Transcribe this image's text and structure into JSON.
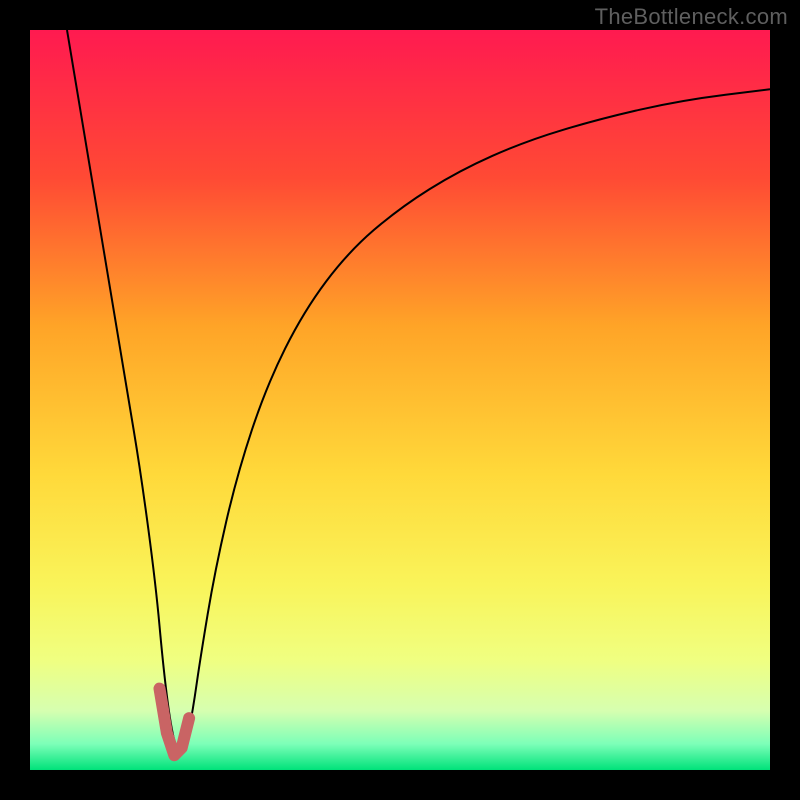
{
  "watermark": "TheBottleneck.com",
  "colors": {
    "frame_bg": "#000000",
    "watermark": "#5f5f5f",
    "curve": "#000000",
    "marker": "#c96464",
    "gradient_stops": [
      {
        "offset": 0.0,
        "color": "#ff1a50"
      },
      {
        "offset": 0.2,
        "color": "#ff4a34"
      },
      {
        "offset": 0.4,
        "color": "#ffa427"
      },
      {
        "offset": 0.6,
        "color": "#ffd93a"
      },
      {
        "offset": 0.75,
        "color": "#f9f45a"
      },
      {
        "offset": 0.85,
        "color": "#f0ff80"
      },
      {
        "offset": 0.92,
        "color": "#d6ffb0"
      },
      {
        "offset": 0.965,
        "color": "#7cffb8"
      },
      {
        "offset": 1.0,
        "color": "#00e27a"
      }
    ]
  },
  "chart_data": {
    "type": "line",
    "title": "",
    "xlabel": "",
    "ylabel": "",
    "xlim": [
      0,
      100
    ],
    "ylim": [
      0,
      100
    ],
    "grid": false,
    "legend": false,
    "series": [
      {
        "name": "bottleneck-curve",
        "x": [
          5,
          7,
          9,
          11,
          13,
          15,
          17,
          18,
          19,
          20,
          21,
          22,
          23,
          25,
          28,
          32,
          37,
          43,
          50,
          58,
          67,
          77,
          88,
          100
        ],
        "y": [
          100,
          88,
          76,
          64,
          52,
          40,
          25,
          14,
          6,
          2,
          3,
          8,
          15,
          27,
          40,
          52,
          62,
          70,
          76,
          81,
          85,
          88,
          90.5,
          92
        ]
      }
    ],
    "markers": {
      "name": "highlighted-range",
      "x": [
        17.5,
        18.5,
        19.5,
        20.5,
        21.5
      ],
      "y": [
        11,
        5,
        2,
        3,
        7
      ]
    }
  }
}
